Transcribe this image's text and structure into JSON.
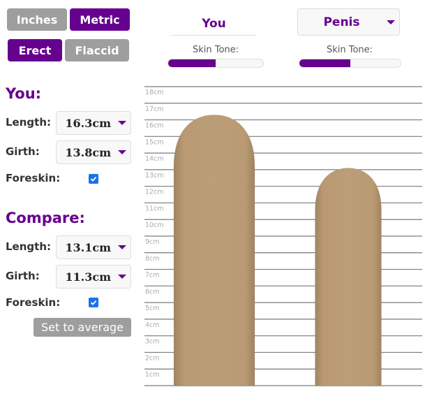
{
  "units": {
    "options": [
      "Inches",
      "Metric"
    ],
    "selected": "Metric"
  },
  "state": {
    "options": [
      "Erect",
      "Flaccid"
    ],
    "selected": "Erect"
  },
  "columns": {
    "you": {
      "title": "You",
      "skin_tone_label": "Skin Tone:",
      "skin_tone_value": 0.5
    },
    "compare": {
      "title": "Penis",
      "skin_tone_label": "Skin Tone:",
      "skin_tone_value": 0.5
    }
  },
  "you": {
    "heading": "You:",
    "length_label": "Length:",
    "length_value": "16.3cm",
    "girth_label": "Girth:",
    "girth_value": "13.8cm",
    "foreskin_label": "Foreskin:",
    "foreskin_checked": true
  },
  "compare": {
    "heading": "Compare:",
    "length_label": "Length:",
    "length_value": "13.1cm",
    "girth_label": "Girth:",
    "girth_value": "11.3cm",
    "foreskin_label": "Foreskin:",
    "foreskin_checked": true,
    "set_average_label": "Set to average"
  },
  "colors": {
    "accent": "#66008f",
    "inactive": "#9e9e9e",
    "skin": "#bb9c76",
    "grid": "#7a7a7a",
    "tick_text": "#aaaaaa"
  },
  "chart_data": {
    "type": "bar",
    "title": "",
    "xlabel": "",
    "ylabel": "",
    "unit": "cm",
    "ylim": [
      0,
      18
    ],
    "grid": true,
    "tick_labels": [
      "1cm",
      "2cm",
      "3cm",
      "4cm",
      "5cm",
      "6cm",
      "7cm",
      "8cm",
      "9cm",
      "10cm",
      "11cm",
      "12cm",
      "13cm",
      "14cm",
      "15cm",
      "16cm",
      "17cm",
      "18cm"
    ],
    "categories": [
      "You",
      "Penis"
    ],
    "series": [
      {
        "name": "Length",
        "values": [
          16.3,
          13.1
        ]
      },
      {
        "name": "Girth",
        "values": [
          13.8,
          11.3
        ]
      }
    ]
  }
}
